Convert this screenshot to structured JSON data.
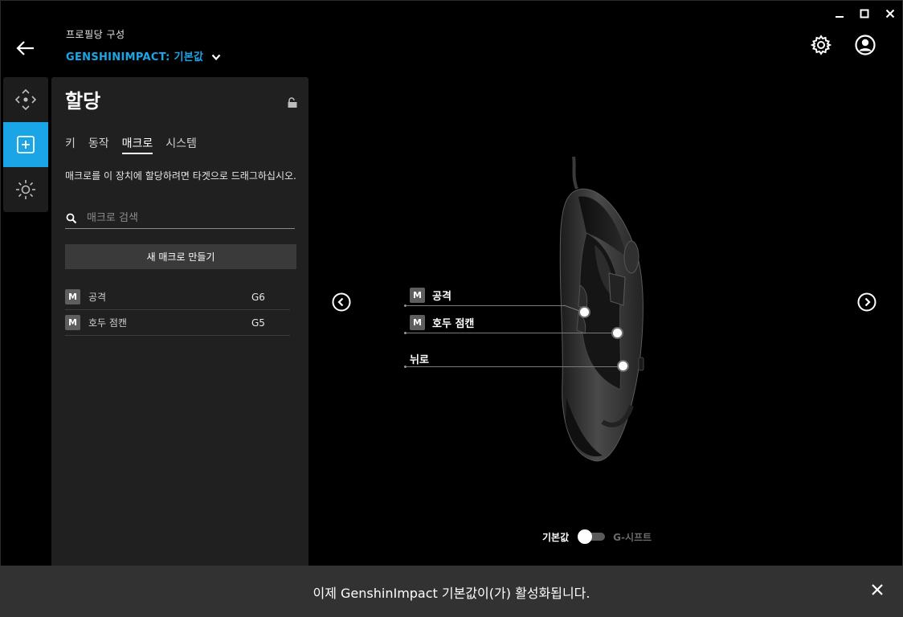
{
  "window": {
    "minimize_icon": "minimize-icon",
    "maximize_icon": "maximize-icon",
    "close_icon": "close-icon"
  },
  "header": {
    "subtitle": "프로필당 구성",
    "profile_name": "GENSHINIMPACT: 기본값",
    "back_icon": "arrow-left-icon",
    "settings_icon": "gear-icon",
    "account_icon": "user-circle-icon"
  },
  "rail": {
    "items": [
      {
        "icon": "move-arrows-icon",
        "active": false
      },
      {
        "icon": "plus-square-icon",
        "active": true
      },
      {
        "icon": "sun-lighting-icon",
        "active": false
      }
    ]
  },
  "panel": {
    "title": "할당",
    "lock_icon": "unlock-icon",
    "tabs": [
      {
        "label": "키",
        "active": false
      },
      {
        "label": "동작",
        "active": false
      },
      {
        "label": "매크로",
        "active": true
      },
      {
        "label": "시스템",
        "active": false
      }
    ],
    "instruction": "매크로를 이 장치에 할당하려면 타겟으로 드래그하십시오.",
    "search_placeholder": "매크로 검색",
    "new_macro_label": "새 매크로 만들기",
    "macros": [
      {
        "badge": "M",
        "name": "공격",
        "key": "G6"
      },
      {
        "badge": "M",
        "name": "호두 점캔",
        "key": "G5"
      }
    ]
  },
  "device": {
    "callouts": [
      {
        "badge": "M",
        "label": "공격"
      },
      {
        "badge": "M",
        "label": "호두 점캔"
      },
      {
        "badge": "",
        "label": "뉘로"
      }
    ],
    "prev_icon": "chevron-left-circle-icon",
    "next_icon": "chevron-right-circle-icon"
  },
  "mode_toggle": {
    "left_label": "기본값",
    "right_label": "G-시프트",
    "state": "off"
  },
  "notification": {
    "text": "이제 GenshinImpact 기본값이(가) 활성화됩니다.",
    "close_icon": "close-icon"
  },
  "colors": {
    "accent": "#1aa6e6",
    "profile_link": "#18a8ea",
    "panel_bg": "#202020",
    "notification_bg": "#323232"
  }
}
